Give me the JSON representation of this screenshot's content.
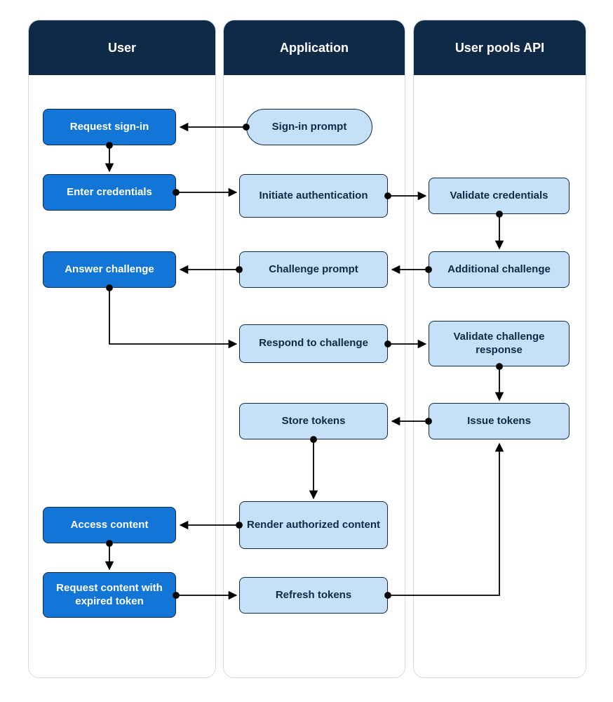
{
  "lanes": {
    "user": {
      "title": "User"
    },
    "application": {
      "title": "Application"
    },
    "api": {
      "title": "User pools API"
    }
  },
  "nodes": {
    "request_signin": "Request sign-in",
    "enter_credentials": "Enter credentials",
    "answer_challenge": "Answer challenge",
    "access_content": "Access content",
    "request_expired": "Request content with expired token",
    "signin_prompt": "Sign-in prompt",
    "initiate_auth": "Initiate authentication",
    "challenge_prompt": "Challenge prompt",
    "respond_challenge": "Respond to challenge",
    "store_tokens": "Store tokens",
    "render_authorized": "Render authorized content",
    "refresh_tokens": "Refresh tokens",
    "validate_credentials": "Validate credentials",
    "additional_challenge": "Additional challenge",
    "validate_response": "Validate challenge response",
    "issue_tokens": "Issue tokens"
  }
}
